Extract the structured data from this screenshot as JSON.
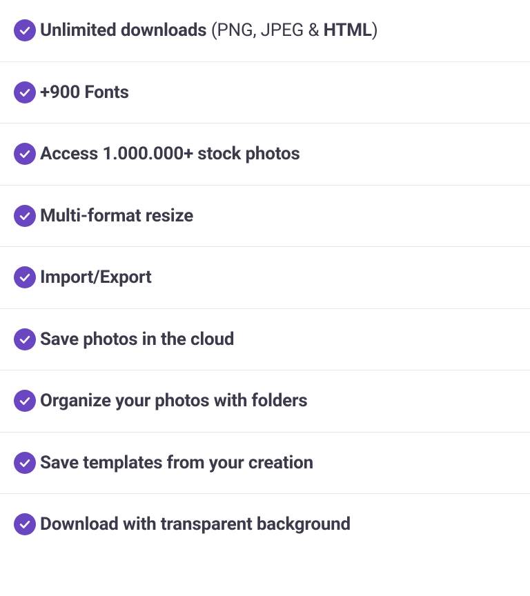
{
  "features": [
    {
      "segments": [
        {
          "text": "Unlimited downloads",
          "bold": true
        },
        {
          "text": " (PNG, JPEG & ",
          "bold": false
        },
        {
          "text": "HTML",
          "bold": true
        },
        {
          "text": ")",
          "bold": false
        }
      ]
    },
    {
      "segments": [
        {
          "text": "+900 Fonts",
          "bold": true
        }
      ]
    },
    {
      "segments": [
        {
          "text": "Access 1.000.000+ stock photos",
          "bold": true
        }
      ]
    },
    {
      "segments": [
        {
          "text": "Multi-format resize",
          "bold": true
        }
      ]
    },
    {
      "segments": [
        {
          "text": "Import/Export",
          "bold": true
        }
      ]
    },
    {
      "segments": [
        {
          "text": "Save photos in the cloud",
          "bold": true
        }
      ]
    },
    {
      "segments": [
        {
          "text": "Organize your photos with folders",
          "bold": true
        }
      ]
    },
    {
      "segments": [
        {
          "text": "Save templates from your creation",
          "bold": true
        }
      ]
    },
    {
      "segments": [
        {
          "text": "Download with transparent background",
          "bold": true
        }
      ]
    }
  ],
  "icon_color": "#6b46c1"
}
